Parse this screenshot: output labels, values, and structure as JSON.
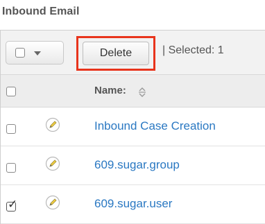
{
  "section": {
    "title": "Inbound Email"
  },
  "toolbar": {
    "delete_label": "Delete",
    "selected_text": "| Selected:  1"
  },
  "table": {
    "header": {
      "name_label": "Name:"
    },
    "rows": [
      {
        "name": "Inbound Case Creation",
        "checked": false
      },
      {
        "name": "609.sugar.group",
        "checked": false
      },
      {
        "name": "609.sugar.user",
        "checked": true
      }
    ]
  },
  "colors": {
    "highlight_border": "#e8341c",
    "link": "#2a78c2",
    "heading": "#555555"
  }
}
